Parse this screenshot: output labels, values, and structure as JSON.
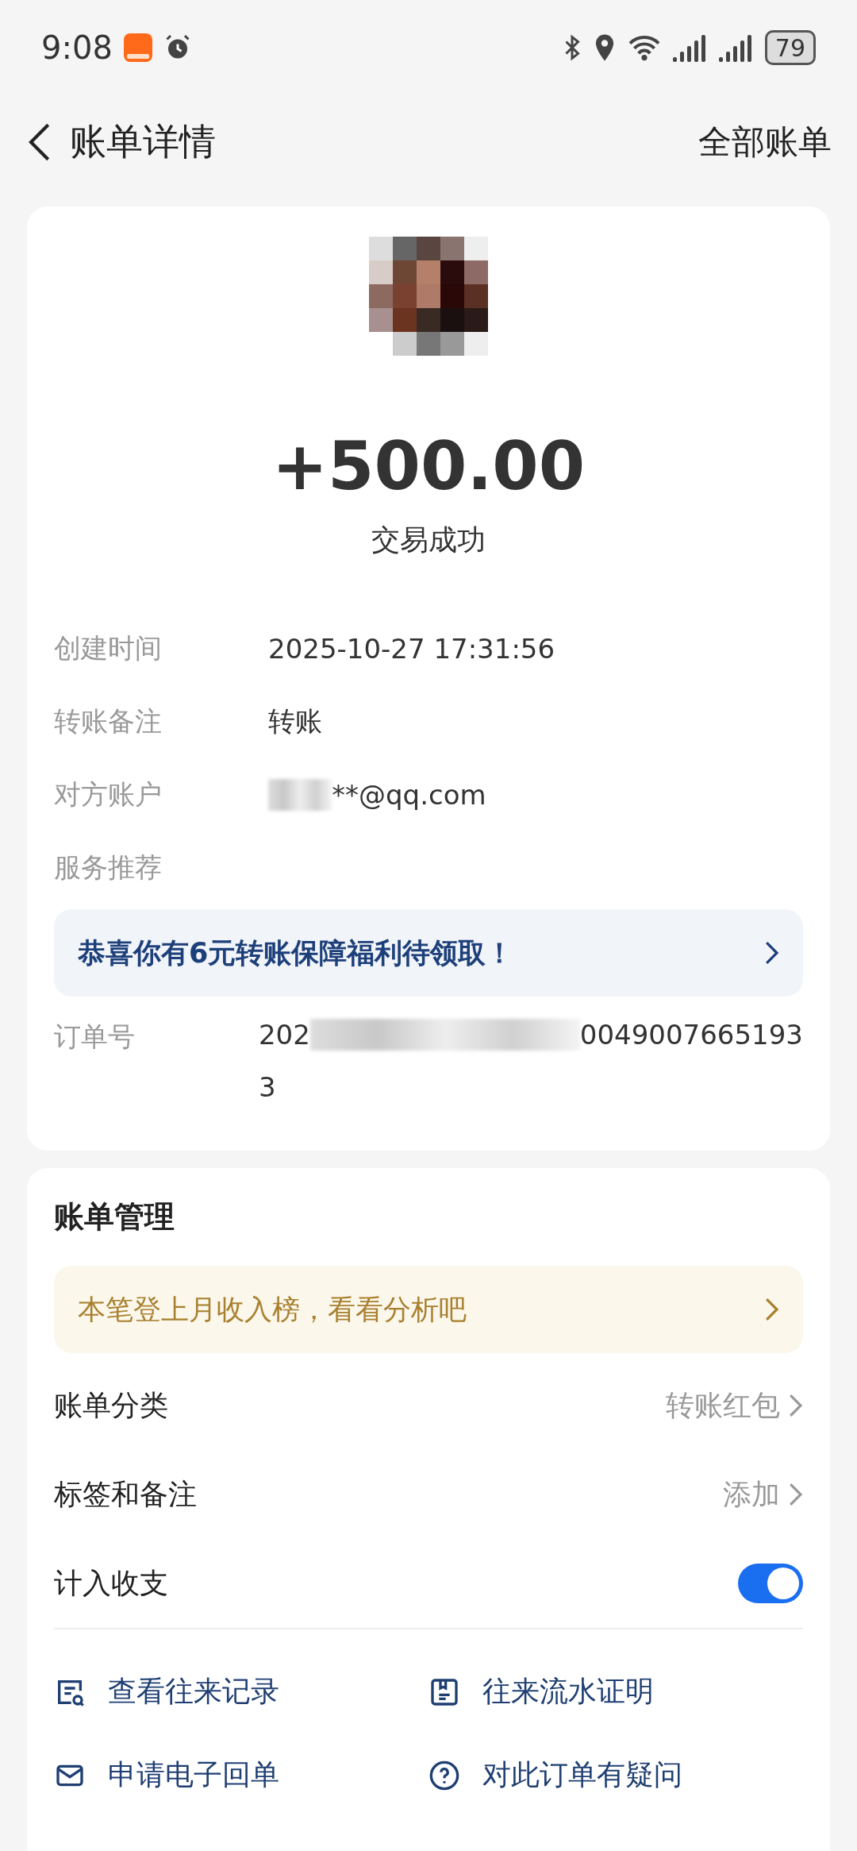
{
  "status_bar": {
    "time": "9:08",
    "battery": "79"
  },
  "header": {
    "title": "账单详情",
    "action": "全部账单"
  },
  "summary": {
    "amount": "+500.00",
    "status": "交易成功"
  },
  "details": [
    {
      "label": "创建时间",
      "value": "2025-10-27 17:31:56",
      "kind": "text"
    },
    {
      "label": "转账备注",
      "value": "转账",
      "kind": "text"
    },
    {
      "label": "对方账户",
      "value": "**@qq.com",
      "kind": "masked"
    },
    {
      "label": "服务推荐",
      "kind": "label"
    }
  ],
  "promo_banner": {
    "text": "恭喜你有6元转账保障福利待领取！"
  },
  "order": {
    "label": "订单号",
    "prefix": "202",
    "suffix": "0049007665193",
    "line_2": "3"
  },
  "management": {
    "title": "账单管理",
    "banner": "本笔登上月收入榜，看看分析吧",
    "rows": [
      {
        "label": "账单分类",
        "value": "转账红包",
        "kind": "link"
      },
      {
        "label": "标签和备注",
        "value": "添加",
        "kind": "link"
      },
      {
        "label": "计入收支",
        "kind": "toggle",
        "on": true
      }
    ],
    "actions": [
      {
        "label": "查看往来记录",
        "kind": "records"
      },
      {
        "label": "往来流水证明",
        "kind": "document"
      },
      {
        "label": "申请电子回单",
        "kind": "mail"
      },
      {
        "label": "对此订单有疑问",
        "kind": "question"
      }
    ]
  }
}
